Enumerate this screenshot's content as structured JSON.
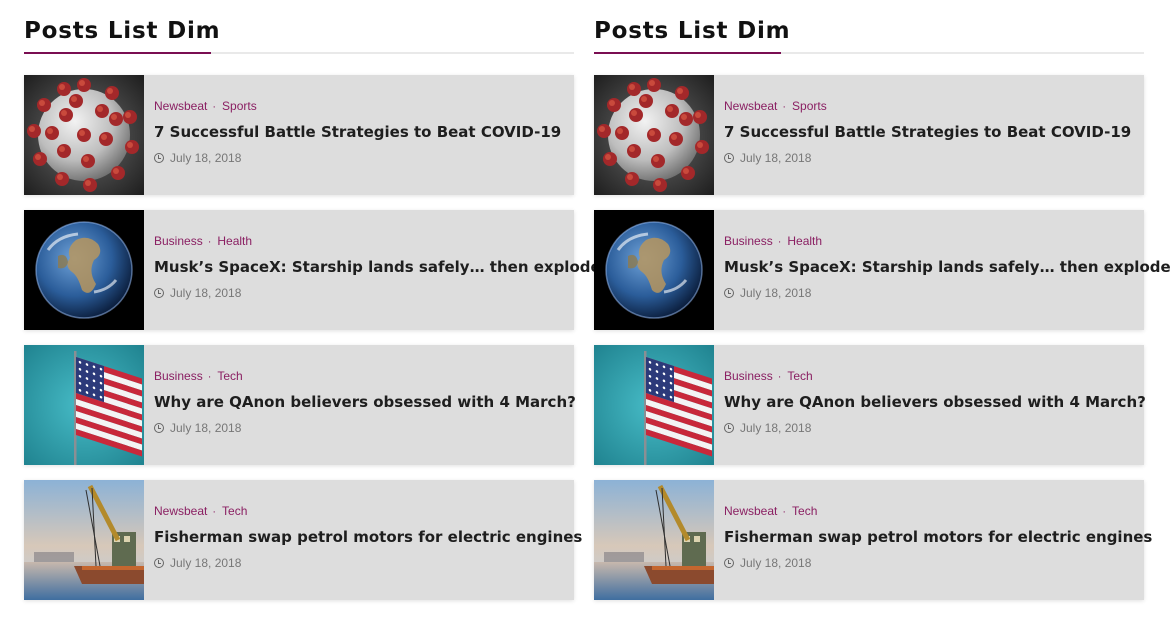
{
  "widgets": [
    {
      "title": "Posts List Dim",
      "posts": [
        {
          "categories": [
            "Newsbeat",
            "Sports"
          ],
          "title": "7 Successful Battle Strategies to Beat COVID-19",
          "date": "July 18, 2018",
          "image": "virus"
        },
        {
          "categories": [
            "Business",
            "Health"
          ],
          "title": "Musk’s SpaceX: Starship lands safely… then explodes",
          "date": "July 18, 2018",
          "image": "earth"
        },
        {
          "categories": [
            "Business",
            "Tech"
          ],
          "title": "Why are QAnon believers obsessed with 4 March?",
          "date": "July 18, 2018",
          "image": "flag"
        },
        {
          "categories": [
            "Newsbeat",
            "Tech"
          ],
          "title": "Fisherman swap petrol motors for electric engines",
          "date": "July 18, 2018",
          "image": "boat"
        }
      ]
    },
    {
      "title": "Posts List Dim",
      "posts": [
        {
          "categories": [
            "Newsbeat",
            "Sports"
          ],
          "title": "7 Successful Battle Strategies to Beat COVID-19",
          "date": "July 18, 2018",
          "image": "virus"
        },
        {
          "categories": [
            "Business",
            "Health"
          ],
          "title": "Musk’s SpaceX: Starship lands safely… then explodes",
          "date": "July 18, 2018",
          "image": "earth"
        },
        {
          "categories": [
            "Business",
            "Tech"
          ],
          "title": "Why are QAnon believers obsessed with 4 March?",
          "date": "July 18, 2018",
          "image": "flag"
        },
        {
          "categories": [
            "Newsbeat",
            "Tech"
          ],
          "title": "Fisherman swap petrol motors for electric engines",
          "date": "July 18, 2018",
          "image": "boat"
        }
      ]
    }
  ],
  "colors": {
    "accent": "#7a0e52",
    "category": "#8a1f62",
    "card_bg": "#dddddd"
  }
}
